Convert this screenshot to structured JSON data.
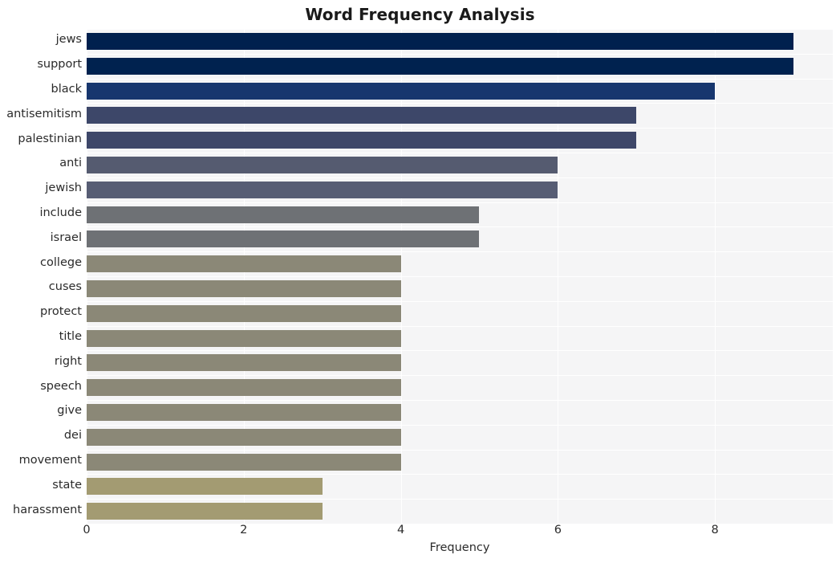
{
  "chart_data": {
    "type": "bar",
    "orientation": "horizontal",
    "title": "Word Frequency Analysis",
    "xlabel": "Frequency",
    "ylabel": "",
    "categories": [
      "jews",
      "support",
      "black",
      "antisemitism",
      "palestinian",
      "anti",
      "jewish",
      "include",
      "israel",
      "college",
      "cuses",
      "protect",
      "title",
      "right",
      "speech",
      "give",
      "dei",
      "movement",
      "state",
      "harassment"
    ],
    "values": [
      9,
      9,
      8,
      7,
      7,
      6,
      6,
      5,
      5,
      4,
      4,
      4,
      4,
      4,
      4,
      4,
      4,
      4,
      3,
      3
    ],
    "bar_colors": [
      "#00204e",
      "#00224f",
      "#17366e",
      "#3d4769",
      "#3e4769",
      "#555b70",
      "#575d74",
      "#6e7175",
      "#6e7175",
      "#8b8877",
      "#8b8877",
      "#8b8877",
      "#8b8877",
      "#8b8877",
      "#8b8877",
      "#8b8877",
      "#8b8877",
      "#8b8877",
      "#a39b72",
      "#a39b72"
    ],
    "xlim": [
      0,
      9.5
    ],
    "xticks": [
      0,
      2,
      4,
      6,
      8
    ],
    "xticklabels": [
      "0",
      "2",
      "4",
      "6",
      "8"
    ],
    "grid": true,
    "grid_color": "#ffffff",
    "plot_background": "#f5f5f6",
    "figure_background": "#ffffff",
    "legend": null
  },
  "axes": {
    "x_label": "Frequency",
    "x_ticks": [
      "0",
      "2",
      "4",
      "6",
      "8"
    ]
  },
  "header": {
    "title": "Word Frequency Analysis"
  }
}
